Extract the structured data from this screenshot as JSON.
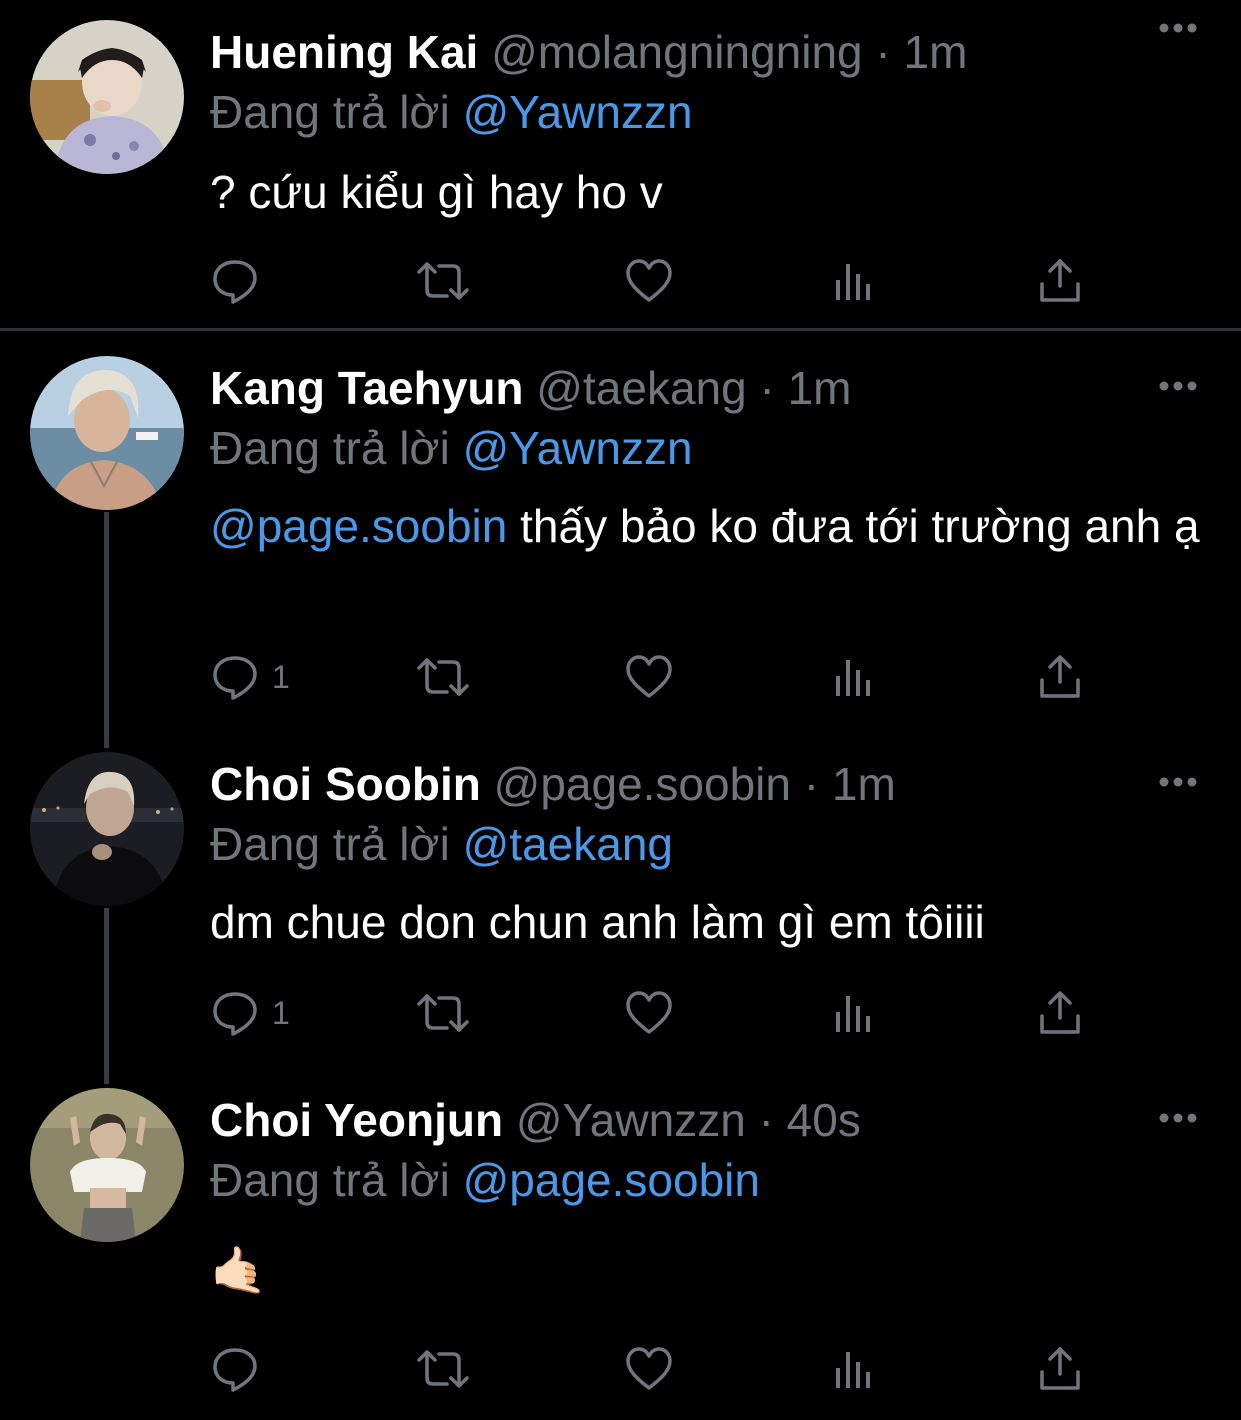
{
  "reply_prefix": "Đang trả lời",
  "colors": {
    "background": "#000000",
    "text": "#ffffff",
    "secondary": "#71767b",
    "link": "#4a99e9",
    "divider": "#2f3336"
  },
  "tweets": [
    {
      "name": "Huening Kai",
      "handle": "@molangningning",
      "dot": "·",
      "time": "1m",
      "replying_to": "@Yawnzzn",
      "text_mention": "",
      "text": "? cứu kiểu gì hay ho v",
      "reply_count": ""
    },
    {
      "name": "Kang Taehyun",
      "handle": "@taekang",
      "dot": "·",
      "time": "1m",
      "replying_to": "@Yawnzzn",
      "text_mention": "@page.soobin",
      "text": " thấy bảo ko đưa tới trường anh ạ",
      "reply_count": "1"
    },
    {
      "name": "Choi Soobin",
      "handle": "@page.soobin",
      "dot": "·",
      "time": "1m",
      "replying_to": "@taekang",
      "text_mention": "",
      "text": "dm chue don chun anh làm gì em tôiiii",
      "reply_count": "1"
    },
    {
      "name": "Choi Yeonjun",
      "handle": "@Yawnzzn",
      "dot": "·",
      "time": "40s",
      "replying_to": "@page.soobin",
      "text_mention": "",
      "text": "🤙🏻",
      "reply_count": ""
    }
  ],
  "action_icons": [
    "reply-icon",
    "retweet-icon",
    "like-icon",
    "analytics-icon",
    "share-icon"
  ]
}
